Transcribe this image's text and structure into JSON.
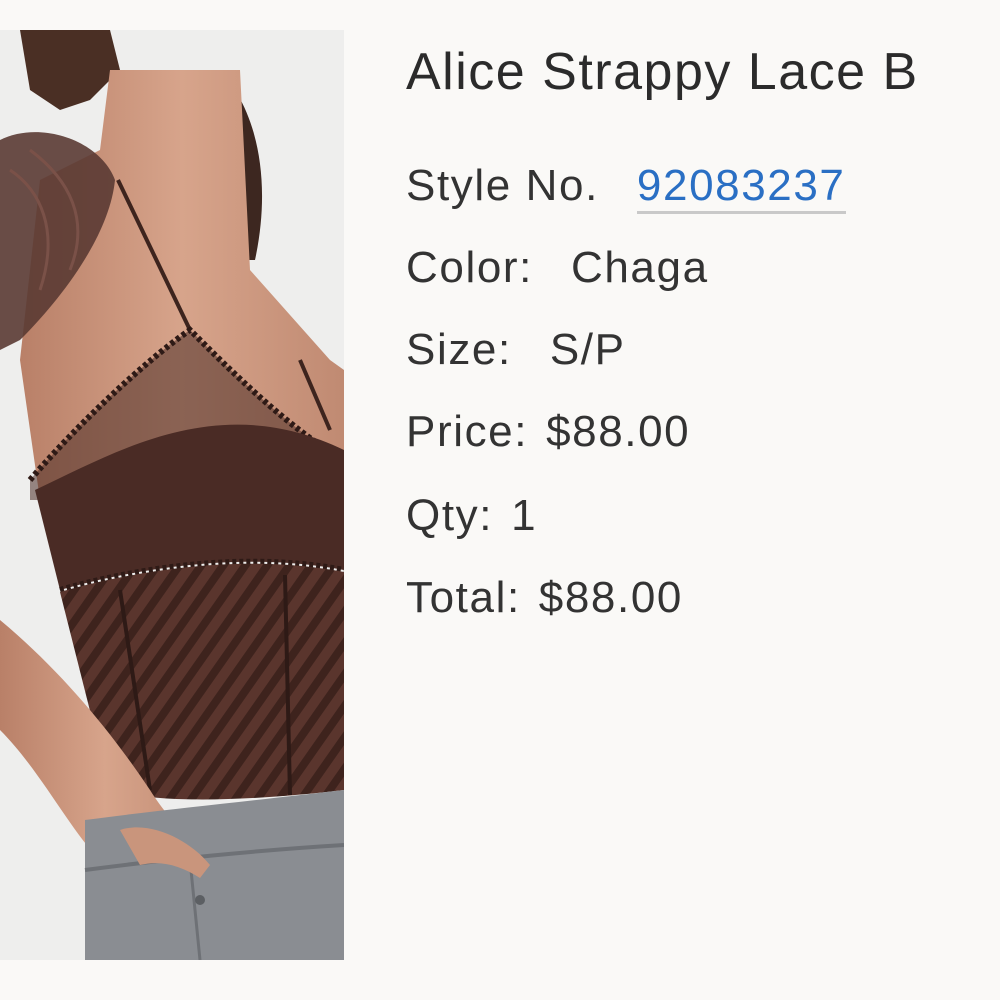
{
  "product": {
    "title": "Alice Strappy Lace B",
    "style_label": "Style No.",
    "style_number": "92083237",
    "color_label": "Color:",
    "color_value": "Chaga",
    "size_label": "Size:",
    "size_value": "S/P",
    "price_label": "Price:",
    "price_value": "$88.00",
    "qty_label": "Qty:",
    "qty_value": "1",
    "total_label": "Total:",
    "total_value": "$88.00"
  },
  "colors": {
    "link": "#2a6fc4",
    "garment": "#4a2b25",
    "denim": "#8a8d92",
    "skin": "#c9957c"
  }
}
